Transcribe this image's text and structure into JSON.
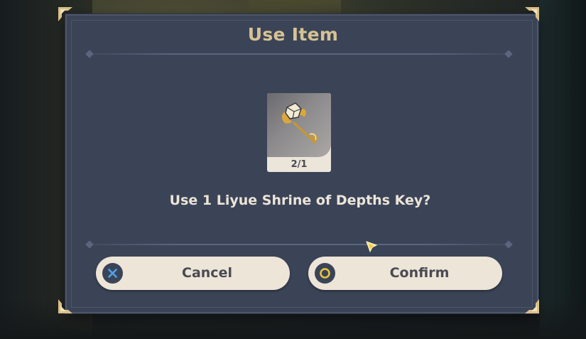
{
  "dialog": {
    "title": "Use Item",
    "question": "Use 1 Liyue Shrine of Depths Key?"
  },
  "item": {
    "name": "Liyue Shrine of Depths Key",
    "icon": "golden-key-icon",
    "count": "2/1"
  },
  "buttons": {
    "cancel": {
      "label": "Cancel",
      "icon": "cross-button-icon"
    },
    "confirm": {
      "label": "Confirm",
      "icon": "circle-button-icon"
    }
  },
  "colors": {
    "panel": "#3b4457",
    "title": "#d7c294",
    "text": "#ece5d8",
    "button_bg": "#ece5d8",
    "button_text": "#4a4a52",
    "cross_icon": "#4ea3e8",
    "circle_icon": "#e8c53a"
  }
}
